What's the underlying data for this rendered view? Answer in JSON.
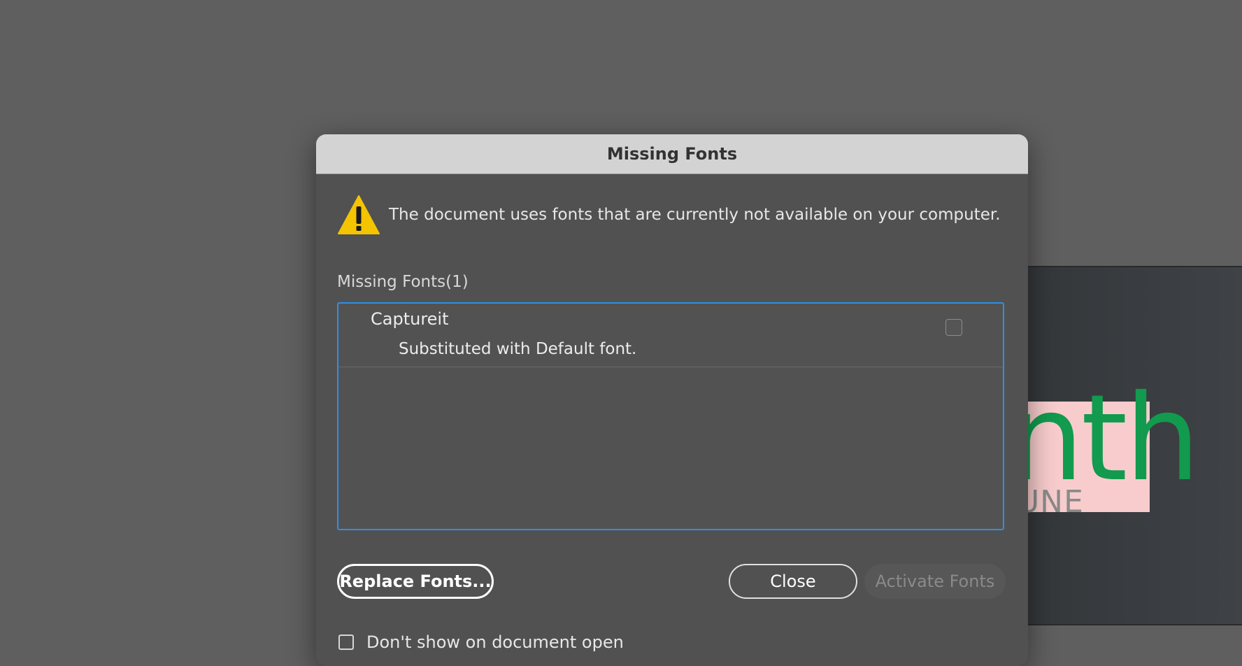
{
  "background_artwork": {
    "big_text": "nth",
    "small_text": "JUNE"
  },
  "dialog": {
    "title": "Missing Fonts",
    "warning_icon": "warning-triangle-icon",
    "warning_message": "The document uses fonts that are currently not available on your computer.",
    "list_label": "Missing Fonts(1)",
    "fonts": [
      {
        "name": "Captureit",
        "status": "Substituted with Default font.",
        "checked": false
      }
    ],
    "buttons": {
      "replace": "Replace Fonts...",
      "close": "Close",
      "activate": "Activate Fonts"
    },
    "dont_show_label": "Don't show on document open",
    "dont_show_checked": false
  },
  "colors": {
    "accent": "#2f8fe6",
    "warning": "#f5c400",
    "artwork_bg": "#f8cccc",
    "artwork_text": "#129a4e"
  }
}
